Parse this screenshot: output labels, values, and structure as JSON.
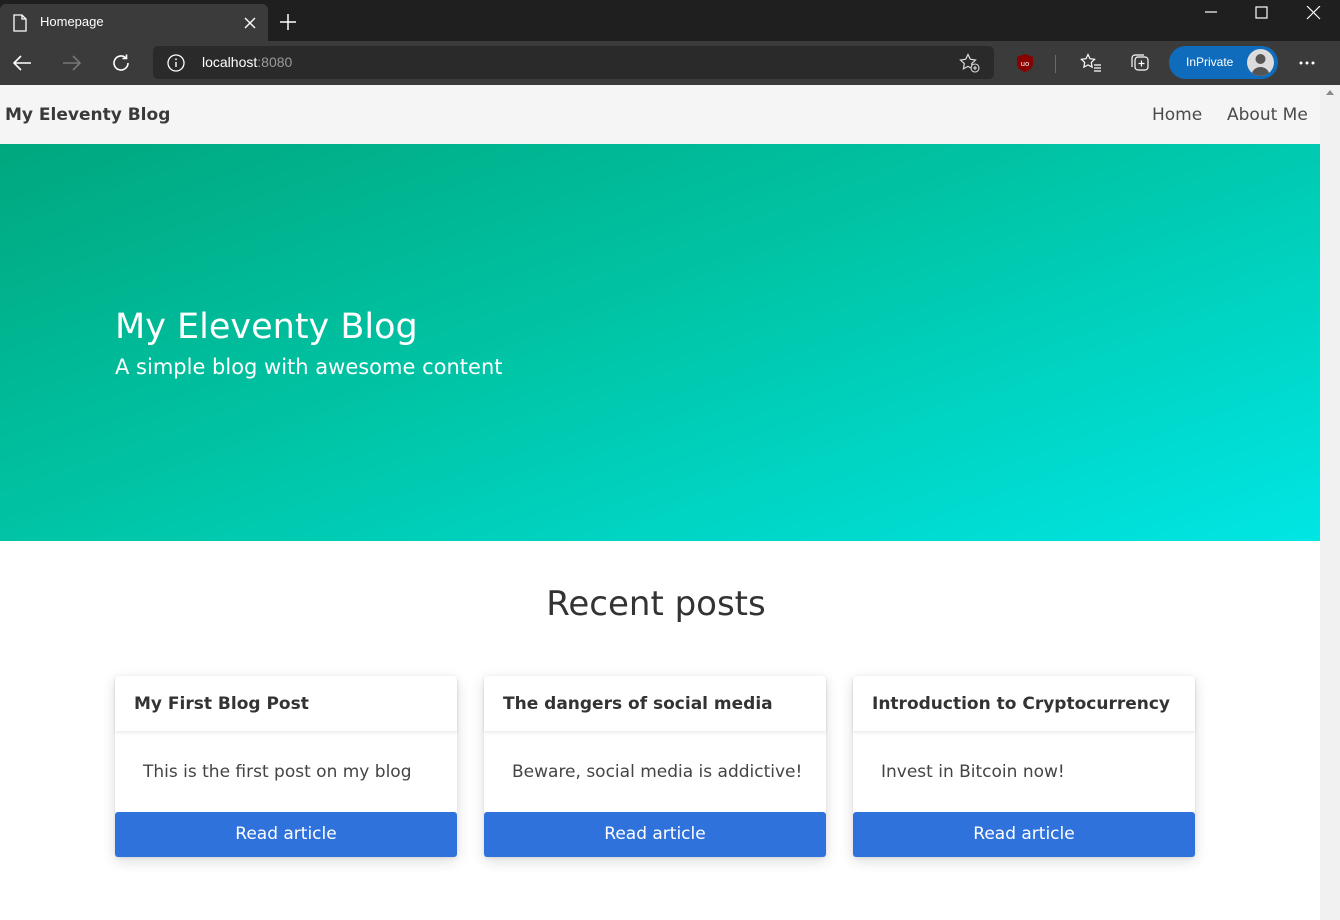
{
  "browser": {
    "tab_title": "Homepage",
    "address": {
      "host": "localhost",
      "port": ":8080"
    },
    "inprivate_label": "InPrivate"
  },
  "site": {
    "brand": "My Eleventy Blog",
    "nav": [
      {
        "label": "Home"
      },
      {
        "label": "About Me"
      }
    ]
  },
  "hero": {
    "title": "My Eleventy Blog",
    "subtitle": "A simple blog with awesome content"
  },
  "posts_section": {
    "title": "Recent posts",
    "posts": [
      {
        "title": "My First Blog Post",
        "excerpt": "This is the first post on my blog",
        "button": "Read article"
      },
      {
        "title": "The dangers of social media",
        "excerpt": "Beware, social media is addictive!",
        "button": "Read article"
      },
      {
        "title": "Introduction to Cryptocurrency",
        "excerpt": "Invest in Bitcoin now!",
        "button": "Read article"
      }
    ]
  },
  "colors": {
    "hero_gradient": [
      "#00a77e",
      "#00e6e4"
    ],
    "button": "#3072dc",
    "inprivate": "#0f6cbd"
  }
}
